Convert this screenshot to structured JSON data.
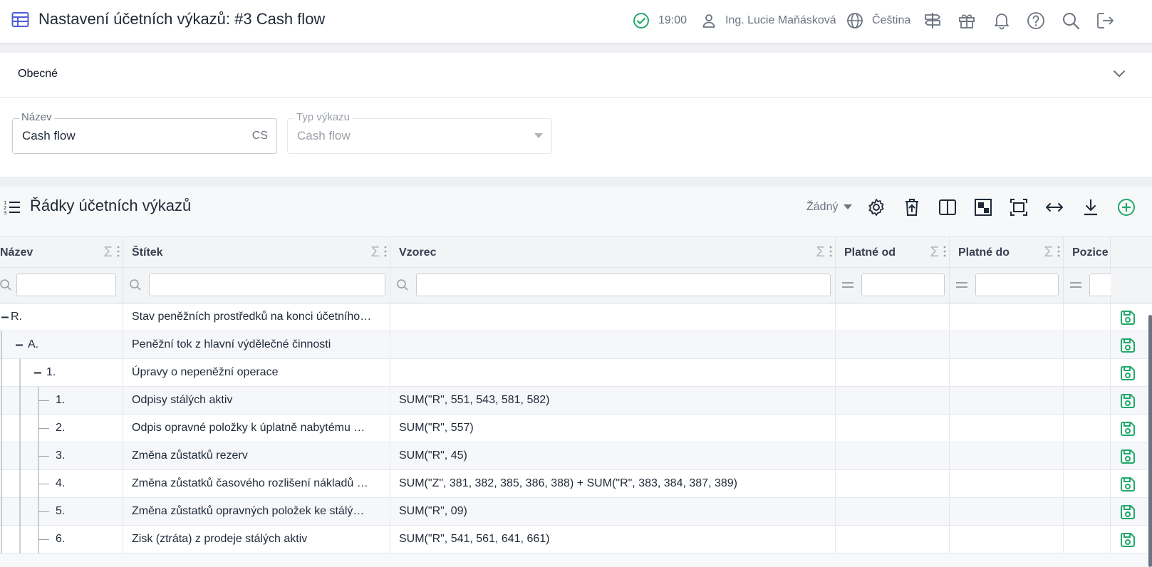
{
  "topbar": {
    "title": "Nastavení účetních výkazů: #3 Cash flow",
    "time": "19:00",
    "user": "Ing. Lucie Maňásková",
    "language": "Čeština"
  },
  "general": {
    "section_title": "Obecné",
    "name_label": "Název",
    "name_value": "Cash flow",
    "name_lang": "CS",
    "type_label": "Typ výkazu",
    "type_value": "Cash flow"
  },
  "table": {
    "title": "Řádky účetních výkazů",
    "group_select": "Žádný",
    "columns": [
      "Název",
      "Štítek",
      "Vzorec",
      "Platné od",
      "Platné do",
      "Pozice"
    ],
    "rows": [
      {
        "code": "R.",
        "label": "Stav peněžních prostředků na konci účetního…",
        "formula": ""
      },
      {
        "code": "A.",
        "label": "Peněžní tok z hlavní výdělečné činnosti",
        "formula": ""
      },
      {
        "code": "1.",
        "label": "Úpravy o nepeněžní operace",
        "formula": ""
      },
      {
        "code": "1.",
        "label": "Odpisy stálých aktiv",
        "formula": "SUM(\"R\", 551, 543, 581, 582)"
      },
      {
        "code": "2.",
        "label": "Odpis opravné položky k úplatně nabytému …",
        "formula": "SUM(\"R\", 557)"
      },
      {
        "code": "3.",
        "label": "Změna zůstatků rezerv",
        "formula": "SUM(\"R\", 45)"
      },
      {
        "code": "4.",
        "label": "Změna zůstatků časového rozlišení nákladů …",
        "formula": "SUM(\"Z\", 381, 382, 385, 386, 388) + SUM(\"R\", 383, 384, 387, 389)"
      },
      {
        "code": "5.",
        "label": "Změna zůstatků opravných položek ke stálý…",
        "formula": "SUM(\"R\", 09)"
      },
      {
        "code": "6.",
        "label": "Zisk (ztráta) z prodeje stálých aktiv",
        "formula": "SUM(\"R\", 541, 561, 641, 661)"
      }
    ]
  },
  "colors": {
    "accent": "#4f5bd5",
    "success": "#22a86a",
    "muted": "#6b7280"
  }
}
